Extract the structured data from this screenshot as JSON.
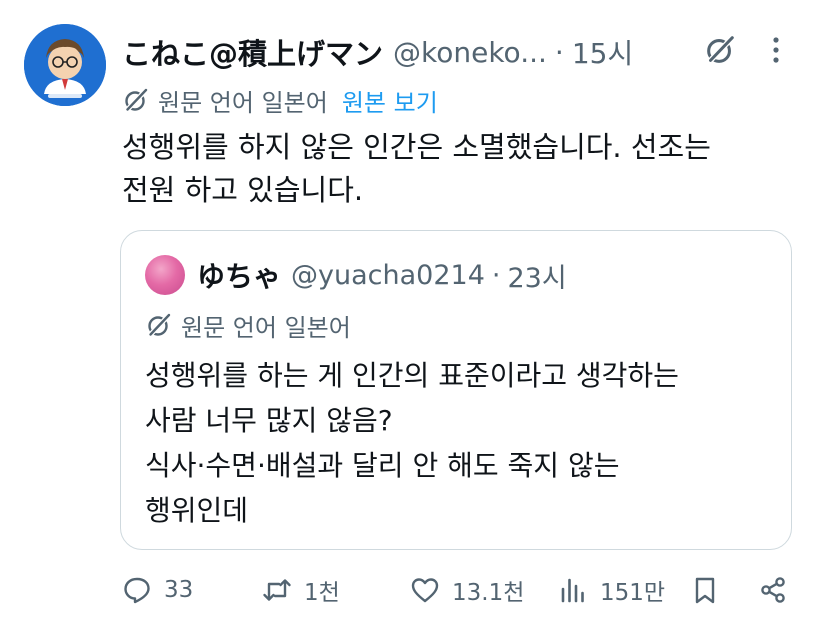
{
  "tweet": {
    "author_name": "こねこ@積上げマン",
    "handle": "@koneko...",
    "separator": "·",
    "time": "15시",
    "translation": {
      "source_label": "원문 언어 일본어",
      "view_original": "원본 보기"
    },
    "text_lines": [
      "성행위를 하지 않은 인간은 소멸했습니다. 선조는",
      "전원 하고 있습니다."
    ]
  },
  "quoted": {
    "author_name": "ゆちゃ",
    "handle": "@yuacha0214",
    "separator": "·",
    "time": "23시",
    "translation_label": "원문 언어 일본어",
    "text_lines": [
      "성행위를 하는 게 인간의 표준이라고 생각하는",
      "사람 너무 많지 않음?",
      "식사·수면·배설과 달리 안 해도 죽지 않는",
      "행위인데"
    ]
  },
  "actions": {
    "reply_count": "33",
    "retweet_count": "1천",
    "like_count": "13.1천",
    "view_count": "151만"
  },
  "icons": {
    "grok": "grok-icon",
    "more": "more-icon",
    "translate": "translate-icon",
    "reply": "reply-icon",
    "retweet": "retweet-icon",
    "like": "like-icon",
    "views": "views-icon",
    "bookmark": "bookmark-icon",
    "share": "share-icon"
  },
  "colors": {
    "text": "#0f1419",
    "secondary": "#536471",
    "link": "#1d9bf0",
    "border": "#cfd9de",
    "avatar_bg": "#1f6fd1"
  }
}
